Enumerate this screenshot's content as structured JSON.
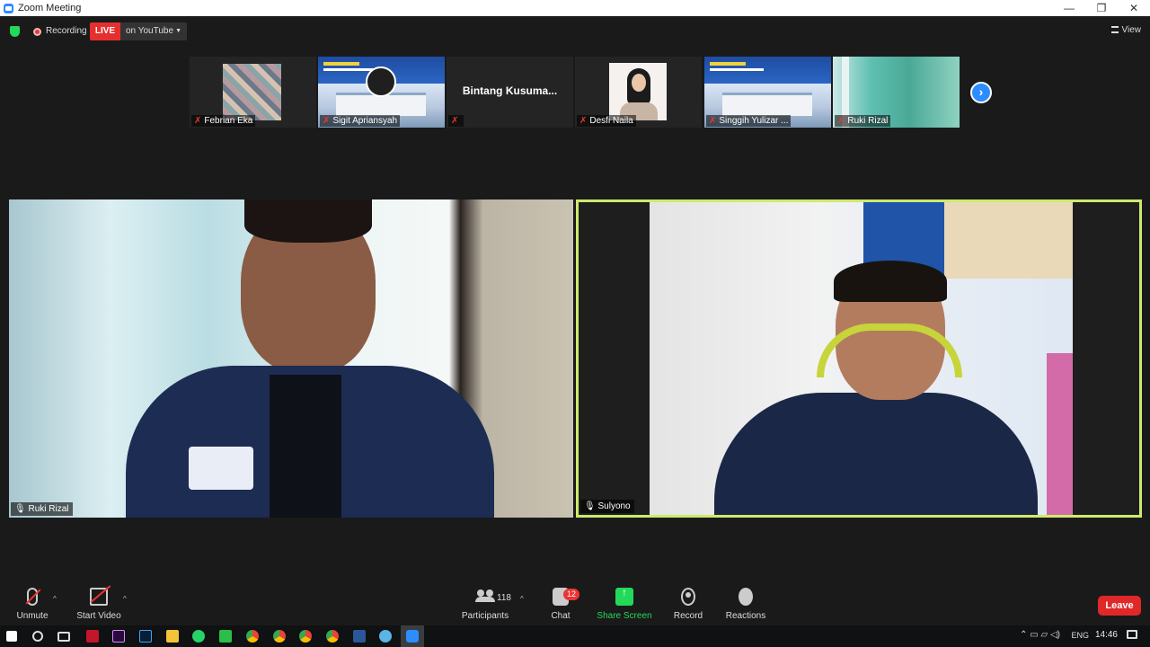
{
  "window": {
    "title": "Zoom Meeting",
    "controls": [
      "—",
      "❐",
      "✕"
    ]
  },
  "top_bar": {
    "recording_label": "Recording",
    "live_badge": "LIVE",
    "stream_target": "on YouTube",
    "view_label": "View"
  },
  "thumbnails": [
    {
      "name": "Febrian Eka",
      "muted": true,
      "content": "tile-mosaic"
    },
    {
      "name": "Sigit Apriansyah",
      "muted": true,
      "content": "banner-with-obs"
    },
    {
      "name": "",
      "display_name": "Bintang  Kusuma...",
      "muted": true,
      "content": "name-only"
    },
    {
      "name": "Desfi Naila",
      "muted": true,
      "content": "portrait"
    },
    {
      "name": "Singgih Yulizar ...",
      "muted": true,
      "content": "banner"
    },
    {
      "name": "Ruki Rizal",
      "muted": true,
      "content": "teal"
    }
  ],
  "main_videos": [
    {
      "name": "Ruki Rizal",
      "active_speaker": false
    },
    {
      "name": "Sulyono",
      "active_speaker": true
    }
  ],
  "toolbar": {
    "unmute": "Unmute",
    "start_video": "Start Video",
    "participants": "Participants",
    "participants_count": "118",
    "chat": "Chat",
    "chat_unread": "12",
    "share_screen": "Share Screen",
    "record": "Record",
    "reactions": "Reactions",
    "leave": "Leave"
  },
  "colors": {
    "accent_blue": "#2D8CFF",
    "live_red": "#e5302f",
    "share_green": "#23d959",
    "active_border": "#cdea6d",
    "leave_red": "#e02828"
  },
  "taskbar": {
    "language": "ENG",
    "time": "14:46",
    "apps": [
      "windows-start",
      "search",
      "task-view",
      "app-red",
      "premiere",
      "photoshop",
      "file-explorer",
      "whatsapp",
      "phone-green",
      "chrome",
      "chrome",
      "chrome",
      "chrome",
      "word",
      "app-blue",
      "zoom"
    ]
  }
}
